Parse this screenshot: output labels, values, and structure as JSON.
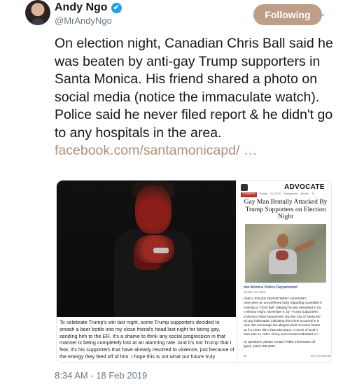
{
  "author": {
    "display_name": "Andy Ngo",
    "handle": "@MrAndyNgo",
    "verified_icon": "✔"
  },
  "follow_button": {
    "label": "Following"
  },
  "more_icon": "⌄",
  "tweet": {
    "text": "On election night, Canadian Chris Ball said he was beaten by anti-gay Trump supporters in Santa Monica. His friend shared a photo on social media (notice the immaculate watch). Police said he never filed report & he didn't go to any hospitals in the area.",
    "link": "facebook.com/santamonicapd/ …"
  },
  "media": {
    "left_caption": "To celebrate Trump's win last night, some Trump supporters decided to smash a beer bottle into my close friend's head last night for being gay, sending him to the ER. It's a shame to think any social progression in that manner is being completely lost at an alarming rate. And it's not Trump that I fear, it's his supporters that have already resorted to violence, just because of the energy they feed off of him. I hope this is not what our future truly",
    "advocate": {
      "logo": "ADVOCATE",
      "nav": [
        "TRENDING",
        "Politics",
        "SCOTUS",
        "Transgender",
        "#50x50",
        "Tri"
      ],
      "headline": "Gay Man Brutally Attacked By Trump Supporters on Election Night",
      "source_title": "nta Monica Police Department",
      "source_date": "vember 10, 2016 ·",
      "body_lines": [
        "ONICA POLICE DEPARTMENT ADVISORY:",
        "nave seen an unconfirmed story regarding a possible h",
        "nvolving a \"Chris Ball\" alleging he was assaulted in Sa",
        "n election night, November 8, by \"Trump Supporters\".",
        "a Monica Police Department and the City of Santa Mo",
        "ed any information indicating this crime occurred in S",
        "nica. We encourage the alleged victim to come forwar",
        "us if a crime did in fact take place. A check of local h",
        "here was no victim of any such incident admitted or t",
        "",
        "ny questions, please contact Public Information Of",
        "iguez, (310) 458-2293."
      ],
      "footer_left": "85",
      "footer_right": "137 Comments"
    }
  },
  "timestamp": "8:34 AM - 18 Feb 2019"
}
